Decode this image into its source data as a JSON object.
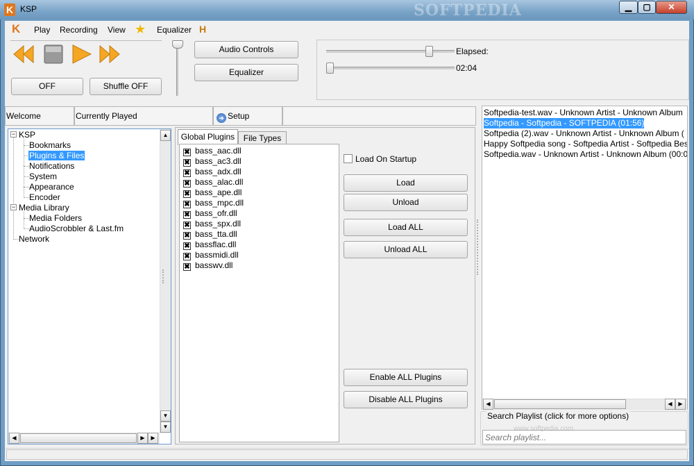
{
  "window": {
    "title": "KSP",
    "watermark": "SOFTPEDIA",
    "watermark_bottom": "www.softpedia.com"
  },
  "menu": {
    "logo": "K",
    "items": [
      "Play",
      "Recording",
      "View",
      "Equalizer"
    ]
  },
  "transport": {
    "off_label": "OFF",
    "shuffle_label": "Shuffle OFF"
  },
  "audio": {
    "audio_controls_label": "Audio Controls",
    "equalizer_label": "Equalizer",
    "volume_level": 0.82,
    "position_level": 0.0
  },
  "seek": {
    "elapsed_label": "Elapsed:",
    "time": "02:04"
  },
  "header_tabs": {
    "welcome": "Welcome",
    "currently_played": "Currently Played",
    "setup": "Setup"
  },
  "tree": {
    "root": "KSP",
    "ksp_children": [
      "Bookmarks",
      "Plugins & Files",
      "Notifications",
      "System",
      "Appearance",
      "Encoder"
    ],
    "media_library": "Media Library",
    "media_children": [
      "Media Folders",
      "AudioScrobbler & Last.fm"
    ],
    "network": "Network",
    "selected": "Plugins & Files"
  },
  "plugins": {
    "tab_global": "Global Plugins",
    "tab_file_types": "File Types",
    "list": [
      "bass_aac.dll",
      "bass_ac3.dll",
      "bass_adx.dll",
      "bass_alac.dll",
      "bass_ape.dll",
      "bass_mpc.dll",
      "bass_ofr.dll",
      "bass_spx.dll",
      "bass_tta.dll",
      "bassflac.dll",
      "bassmidi.dll",
      "basswv.dll"
    ],
    "load_on_startup_label": "Load On Startup",
    "load_label": "Load",
    "unload_label": "Unload",
    "load_all_label": "Load ALL",
    "unload_all_label": "Unload ALL",
    "enable_all_label": "Enable ALL Plugins",
    "disable_all_label": "Disable ALL Plugins"
  },
  "playlist": {
    "items": [
      "Softpedia-test.wav - Unknown Artist - Unknown Album",
      "Softpedia - Softpedia - SOFTPEDIA (01:56)",
      "Softpedia (2).wav - Unknown Artist - Unknown Album (",
      "Happy Softpedia song - Softpedia Artist - Softpedia Best",
      "Softpedia.wav - Unknown Artist - Unknown Album (00:0"
    ],
    "selected_index": 1,
    "search_caption": "Search Playlist (click for more options)",
    "search_placeholder": "Search playlist..."
  },
  "colors": {
    "accent": "#e0761c",
    "selection": "#3399ff",
    "title_bar": "#79a3c7"
  }
}
